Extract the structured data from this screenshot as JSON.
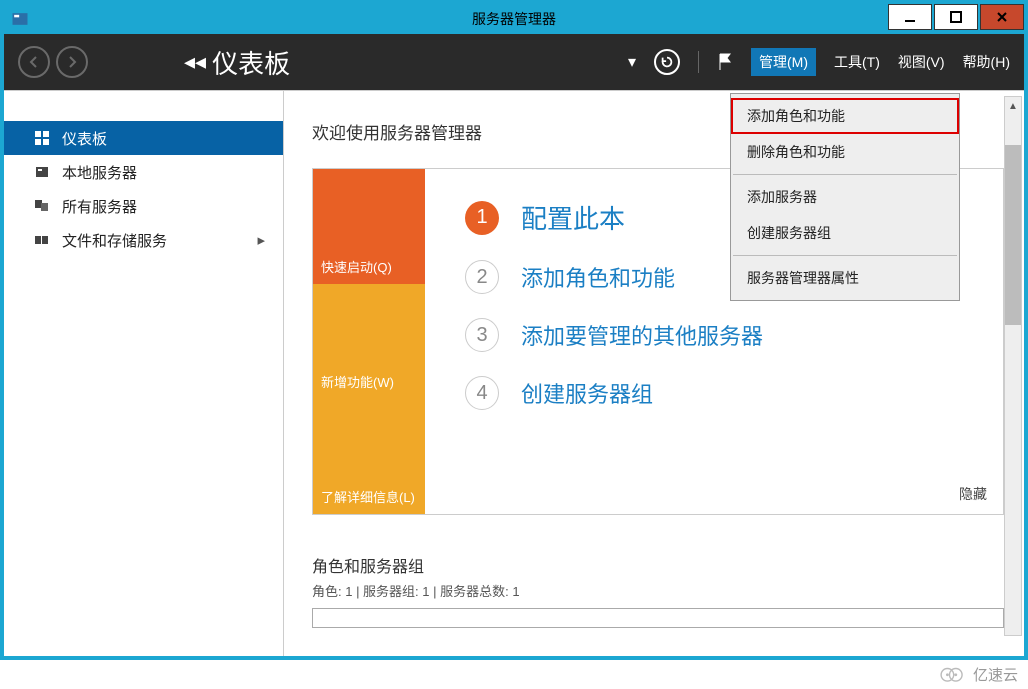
{
  "window": {
    "title": "服务器管理器"
  },
  "toolbar": {
    "dash_label": "仪表板",
    "menu": {
      "manage": "管理(M)",
      "tools": "工具(T)",
      "view": "视图(V)",
      "help": "帮助(H)"
    }
  },
  "sidebar": {
    "items": [
      {
        "label": "仪表板",
        "icon": "dashboard"
      },
      {
        "label": "本地服务器",
        "icon": "server"
      },
      {
        "label": "所有服务器",
        "icon": "servers"
      },
      {
        "label": "文件和存储服务",
        "icon": "storage",
        "expandable": true
      }
    ]
  },
  "main": {
    "welcome": "欢迎使用服务器管理器",
    "tiles": [
      {
        "label": "快速启动(Q)"
      },
      {
        "label": "新增功能(W)"
      },
      {
        "label": "了解详细信息(L)"
      }
    ],
    "steps": [
      {
        "num": "1",
        "label": "配置此本"
      },
      {
        "num": "2",
        "label": "添加角色和功能"
      },
      {
        "num": "3",
        "label": "添加要管理的其他服务器"
      },
      {
        "num": "4",
        "label": "创建服务器组"
      }
    ],
    "hide": "隐藏",
    "group_title": "角色和服务器组",
    "group_sub": "角色: 1 | 服务器组: 1 | 服务器总数: 1"
  },
  "dropdown": {
    "items": [
      "添加角色和功能",
      "删除角色和功能",
      "添加服务器",
      "创建服务器组",
      "服务器管理器属性"
    ]
  },
  "watermark": "亿速云"
}
